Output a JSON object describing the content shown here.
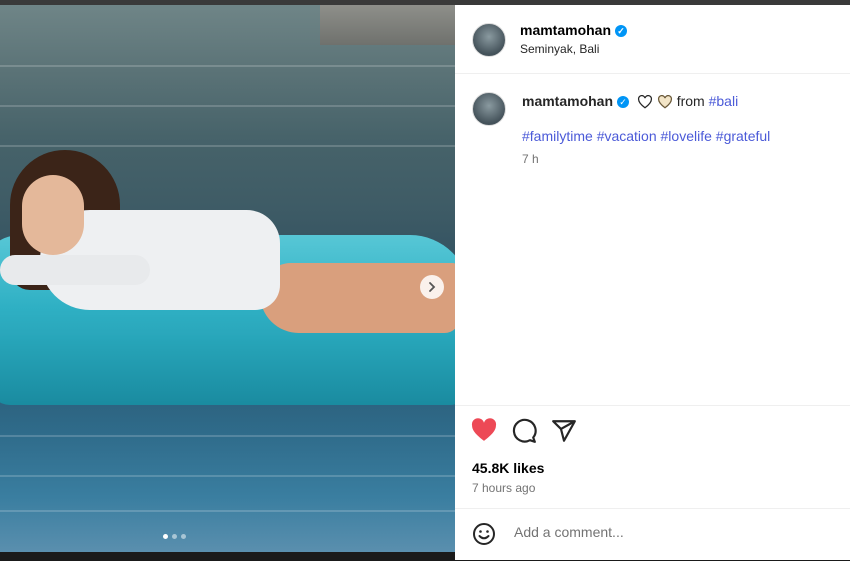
{
  "post": {
    "username": "mamtamohan",
    "location": "Seminyak, Bali",
    "caption_from": "from",
    "caption_place_tag": "#bali",
    "hashtags": [
      "#familytime",
      "#vacation",
      "#lovelife",
      "#grateful"
    ],
    "caption_time": "7 h",
    "likes": "45.8K likes",
    "posted_ago": "7 hours ago",
    "carousel_index": 1,
    "carousel_total": 3
  },
  "comment": {
    "placeholder": "Add a comment..."
  },
  "icons": {
    "verified": "verified-badge-icon",
    "like": "heart-icon",
    "comment": "comment-icon",
    "share": "send-icon",
    "emoji": "emoji-icon",
    "next": "chevron-right-icon"
  },
  "colors": {
    "like_active": "#ed4956",
    "hashtag": "#4b5ad8",
    "verified": "#0095f6"
  }
}
